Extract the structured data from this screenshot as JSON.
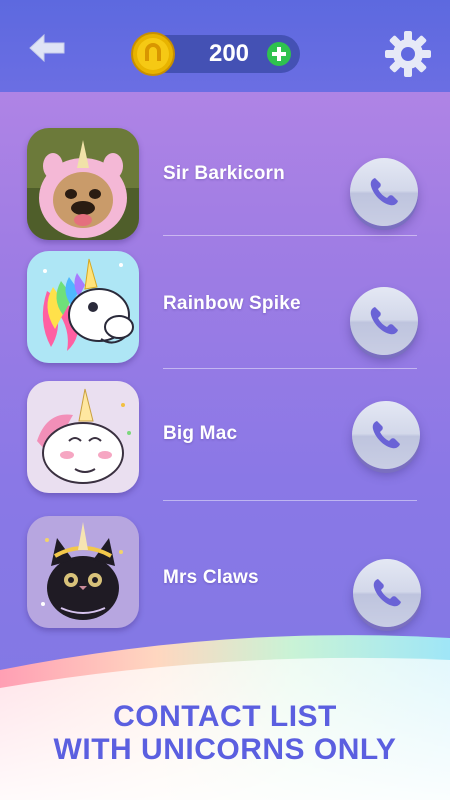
{
  "header": {
    "back_icon": "back-arrow-icon",
    "coin_icon": "horseshoe-coin-icon",
    "coins": "200",
    "add_icon": "plus-icon",
    "settings_icon": "gear-icon"
  },
  "contacts": [
    {
      "name": "Sir Barkicorn",
      "avatar": "bulldog-unicorn-costume-photo",
      "call_icon": "phone-icon"
    },
    {
      "name": "Rainbow Spike",
      "avatar": "rainbow-mane-unicorn-cartoon",
      "call_icon": "phone-icon"
    },
    {
      "name": "Big Mac",
      "avatar": "white-unicorn-pink-mane-cartoon",
      "call_icon": "phone-icon"
    },
    {
      "name": "Mrs Claws",
      "avatar": "black-kitten-unicorn-headband",
      "call_icon": "phone-icon"
    }
  ],
  "banner": {
    "line1": "CONTACT LIST",
    "line2": "WITH UNICORNS ONLY"
  },
  "colors": {
    "header": "#6169e0",
    "accent": "#5b5fe0",
    "coin_gold": "#e8b400",
    "add_green": "#2fc24e",
    "call_button": "#d3d8ea",
    "phone_icon": "#6a63d6"
  }
}
